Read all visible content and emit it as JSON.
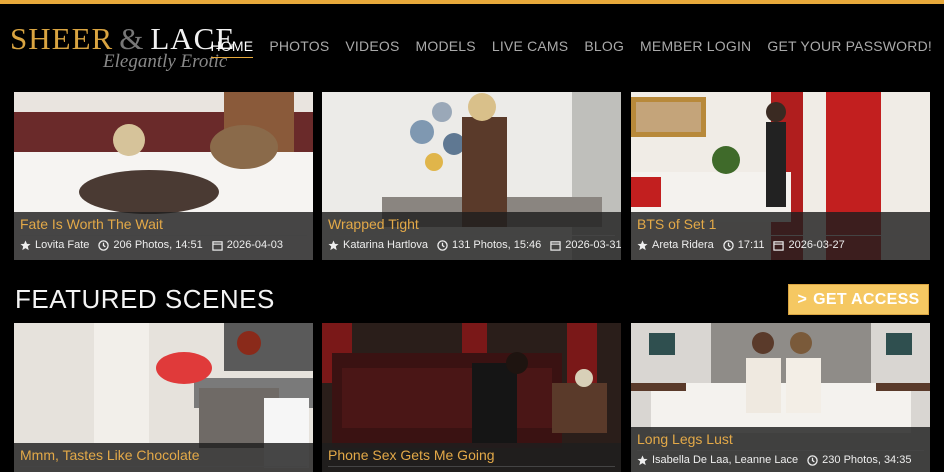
{
  "brand": {
    "name_left": "Sheer",
    "ampersand": "&",
    "name_right": "Lace",
    "tagline": "Elegantly Erotic",
    "accent": "#e8a93a"
  },
  "nav": [
    {
      "label": "Home",
      "active": true
    },
    {
      "label": "Photos"
    },
    {
      "label": "Videos"
    },
    {
      "label": "Models"
    },
    {
      "label": "Live Cams"
    },
    {
      "label": "Blog"
    },
    {
      "label": "Member Login"
    },
    {
      "label": "Get Your Password!"
    }
  ],
  "latest": [
    {
      "title": "Fate Is Worth The Wait",
      "model": "Lovita Fate",
      "stats": "206 Photos, 14:51",
      "date": "2026-04-03"
    },
    {
      "title": "Wrapped Tight",
      "model": "Katarina Hartlova",
      "stats": "131 Photos, 15:46",
      "date": "2026-03-31"
    },
    {
      "title": "BTS of Set 1",
      "model": "Areta Ridera",
      "stats": "17:11",
      "date": "2026-03-27"
    }
  ],
  "featured": {
    "heading": "Featured Scenes",
    "cta": "Get Access",
    "cta_arrow": ">",
    "items": [
      {
        "title": "Mmm, Tastes Like Chocolate",
        "model": "",
        "stats": ""
      },
      {
        "title": "Phone Sex Gets Me Going",
        "model": "",
        "stats": ""
      },
      {
        "title": "Long Legs Lust",
        "model": "Isabella De Laa, Leanne Lace",
        "stats": "230 Photos, 34:35"
      }
    ]
  }
}
